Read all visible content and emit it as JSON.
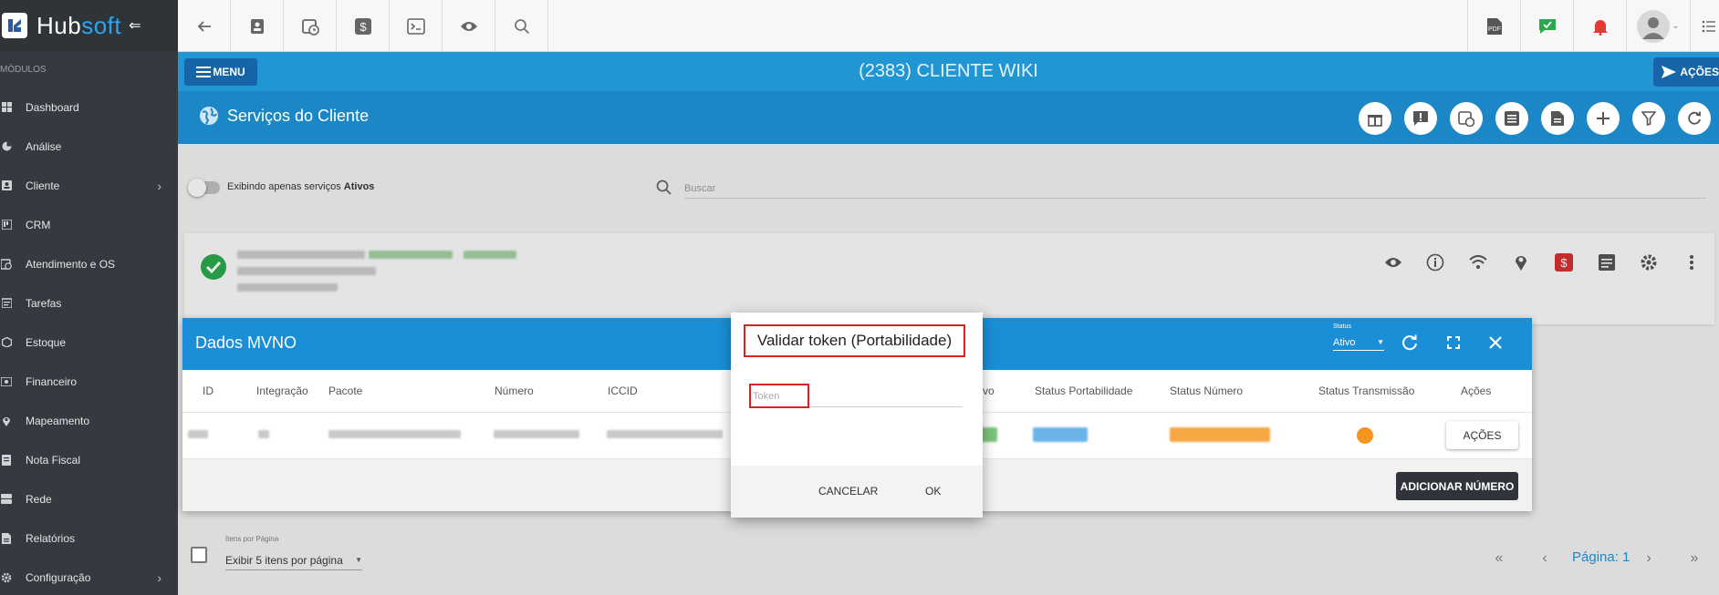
{
  "app": {
    "brand_main": "Hub",
    "brand_accent": "soft"
  },
  "sidebar": {
    "section_label": "MÓDULOS",
    "items": [
      {
        "label": "Dashboard",
        "icon": "grid-icon"
      },
      {
        "label": "Análise",
        "icon": "pie-chart-icon"
      },
      {
        "label": "Cliente",
        "icon": "user-card-icon",
        "has_submenu": true
      },
      {
        "label": "CRM",
        "icon": "kanban-icon"
      },
      {
        "label": "Atendimento e OS",
        "icon": "calendar-clock-icon"
      },
      {
        "label": "Tarefas",
        "icon": "tasks-icon"
      },
      {
        "label": "Estoque",
        "icon": "box-icon"
      },
      {
        "label": "Financeiro",
        "icon": "money-icon"
      },
      {
        "label": "Mapeamento",
        "icon": "map-pin-icon"
      },
      {
        "label": "Nota Fiscal",
        "icon": "receipt-icon"
      },
      {
        "label": "Rede",
        "icon": "network-icon"
      },
      {
        "label": "Relatórios",
        "icon": "report-icon"
      },
      {
        "label": "Configuração",
        "icon": "gear-icon",
        "has_submenu": true
      }
    ]
  },
  "header": {
    "menu_label": "MENU",
    "client_title": "(2383) CLIENTE WIKI",
    "acoes_label": "AÇÕES",
    "services_title": "Serviços do Cliente"
  },
  "filter": {
    "toggle_text": "Exibindo apenas serviços ",
    "toggle_bold": "Ativos",
    "search_placeholder": "Buscar"
  },
  "mvno": {
    "title": "Dados MVNO",
    "status_label": "Status",
    "status_value": "Ativo",
    "columns": [
      "ID",
      "Integração",
      "Pacote",
      "Número",
      "ICCID",
      "vo",
      "Status Portabilidade",
      "Status Número",
      "Status Transmissão",
      "Ações"
    ],
    "row_actions_label": "AÇÕES",
    "add_number_label": "ADICIONAR NÚMERO"
  },
  "dialog": {
    "title": "Validar token (Portabilidade)",
    "token_placeholder": "Token",
    "cancel_label": "CANCELAR",
    "ok_label": "OK"
  },
  "pagination": {
    "items_per_page_label": "Itens por Página",
    "items_per_page_value": "Exibir 5 itens por página",
    "page_text": "Página: 1"
  },
  "colors": {
    "sidebar_bg": "#353a40",
    "primary_blue": "#2196d3",
    "panel_blue": "#1a8fd8",
    "highlight_red": "#e02020",
    "status_orange": "#f7941d"
  }
}
